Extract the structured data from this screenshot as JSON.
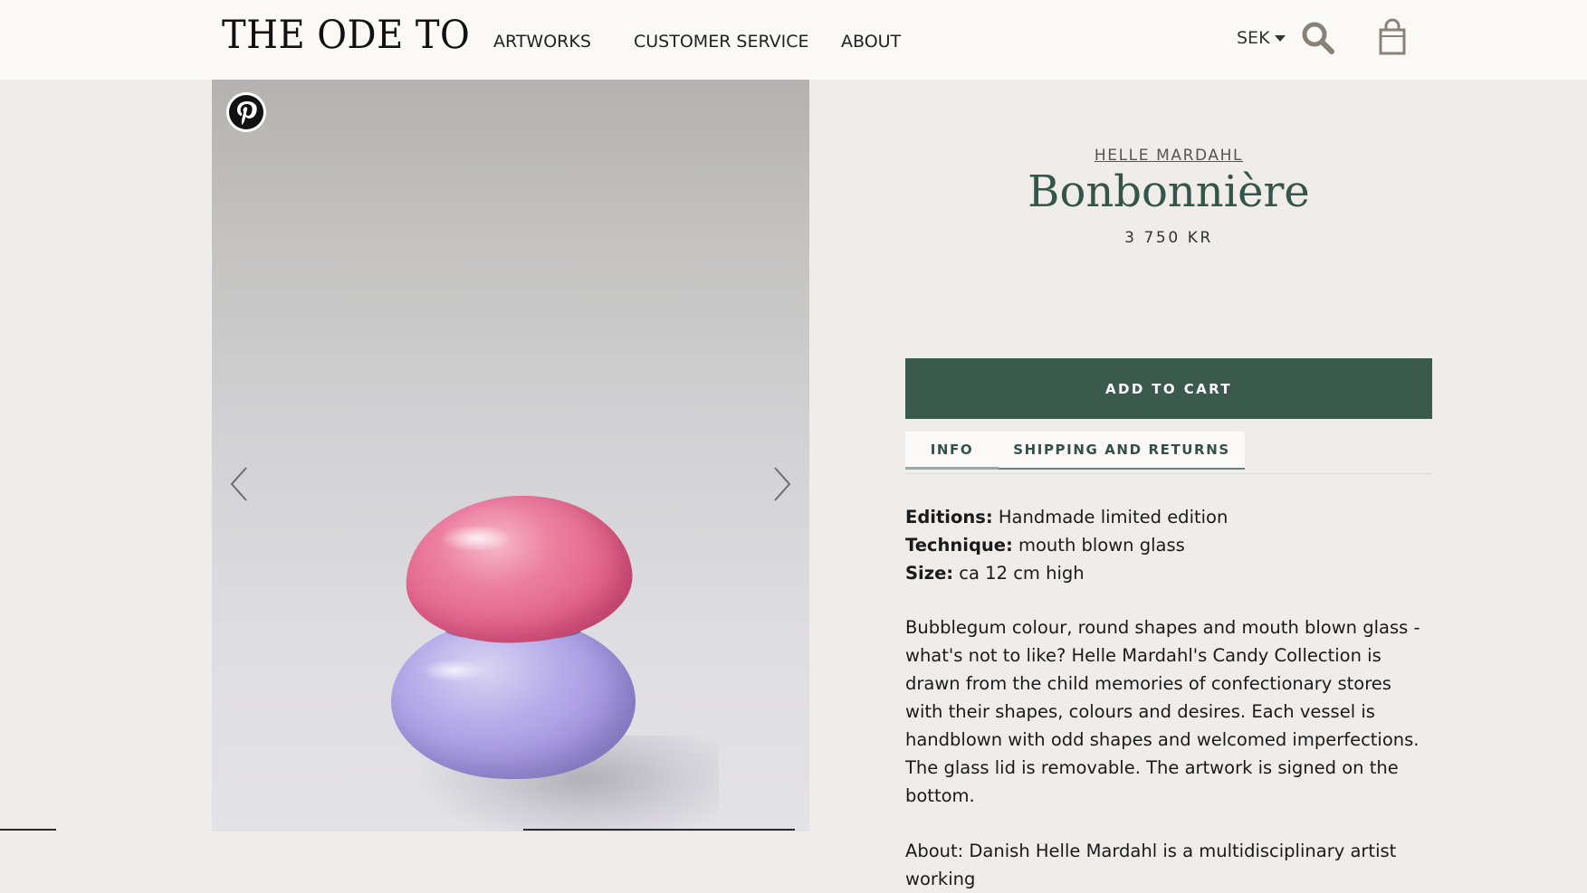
{
  "header": {
    "logo": "THE ODE TO",
    "nav": [
      "ARTWORKS",
      "CUSTOMER SERVICE",
      "ABOUT"
    ],
    "currency": "SEK",
    "search_icon": "search-icon",
    "cart_icon": "shopping-bag-icon"
  },
  "gallery": {
    "pin_icon": "pinterest-icon",
    "prev_icon": "chevron-left-icon",
    "next_icon": "chevron-right-icon"
  },
  "product": {
    "artist": "HELLE MARDAHL",
    "title": "Bonbonnière",
    "price": "3 750 KR",
    "add_to_cart": "ADD TO CART",
    "tabs": [
      "INFO",
      "SHIPPING AND RETURNS"
    ],
    "specs": [
      {
        "label": "Editions:",
        "value": " Handmade limited edition"
      },
      {
        "label": "Technique:",
        "value": " mouth blown glass"
      },
      {
        "label": "Size:",
        "value": " ca 12 cm high"
      }
    ],
    "description": "Bubblegum colour, round shapes and mouth blown glass - what's not to like? Helle Mardahl's Candy Collection is drawn from the child memories of confectionary stores with their shapes, colours and desires. Each vessel is handblown with odd shapes and welcomed imperfections. The glass lid is removable. The artwork is signed on the bottom.",
    "about": "About: Danish Helle Mardahl is a multidisciplinary artist working"
  },
  "colors": {
    "accent": "#3a5a4e",
    "title": "#33554a",
    "background": "#efece9",
    "header": "#faf9f6"
  }
}
